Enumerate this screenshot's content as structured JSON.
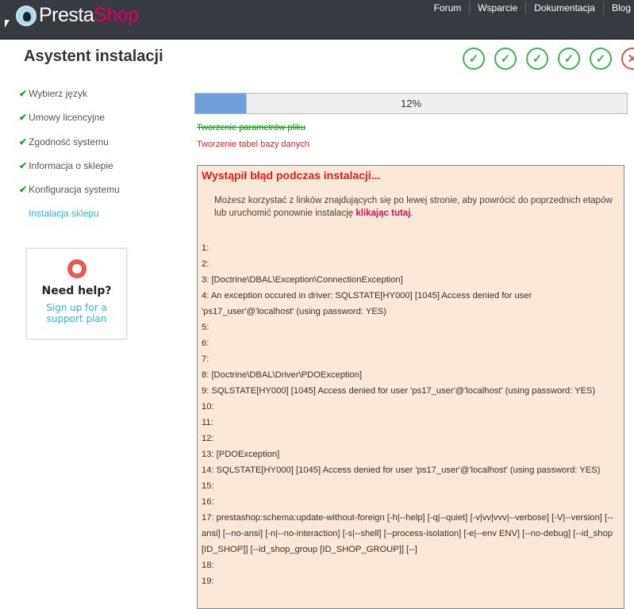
{
  "header": {
    "brand_a": "Presta",
    "brand_b": "Shop",
    "nav": [
      "Forum",
      "Wsparcie",
      "Dokumentacja",
      "Blog"
    ]
  },
  "title": "Asystent instalacji",
  "steps": [
    {
      "status": "done",
      "icon": "check-icon",
      "glyph": "✓"
    },
    {
      "status": "done",
      "icon": "check-icon",
      "glyph": "✓"
    },
    {
      "status": "done",
      "icon": "check-icon",
      "glyph": "✓"
    },
    {
      "status": "done",
      "icon": "check-icon",
      "glyph": "✓"
    },
    {
      "status": "done",
      "icon": "check-icon",
      "glyph": "✓"
    },
    {
      "status": "error",
      "icon": "cross-icon",
      "glyph": "✕"
    }
  ],
  "sidebar": {
    "items": [
      "Wybierz język",
      "Umowy licencyjne",
      "Zgodność systemu",
      "Informacja o sklepie",
      "Konfiguracja systemu"
    ],
    "current": "Instalacja sklepu",
    "check": "✔"
  },
  "help": {
    "title": "Need help?",
    "link": "Sign up for a support plan"
  },
  "progress": {
    "percent": 12,
    "label": "12%"
  },
  "tasks": {
    "done": "Tworzenie parametrów pliku",
    "failed": "Tworzenie tabel bazy danych"
  },
  "error": {
    "title": "Wystąpił błąd podczas instalacji...",
    "msg_before": "Możesz korzystać z linków znajdujących się po lewej stronie, aby powrócić do poprzednich etapów lub uruchomić ponownie instalację ",
    "msg_link": "klikając tutaj",
    "msg_after": ".",
    "lines": [
      "1:",
      "2:",
      "3: [Doctrine\\DBAL\\Exception\\ConnectionException]",
      "4: An exception occured in driver: SQLSTATE[HY000] [1045] Access denied for user 'ps17_user'@'localhost' (using password: YES)",
      "5:",
      "6:",
      "7:",
      "8: [Doctrine\\DBAL\\Driver\\PDOException]",
      "9: SQLSTATE[HY000] [1045] Access denied for user 'ps17_user'@'localhost' (using password: YES)",
      "10:",
      "11:",
      "12:",
      "13: [PDOException]",
      "14: SQLSTATE[HY000] [1045] Access denied for user 'ps17_user'@'localhost' (using password: YES)",
      "15:",
      "16:",
      "17: prestashop:schema:update-without-foreign [-h|--help] [-q|--quiet] [-v|vv|vvv|--verbose] [-V|--version] [--ansi] [--no-ansi] [-n|--no-interaction] [-s|--shell] [--process-isolation] [-e|--env ENV] [--no-debug] [--id_shop [ID_SHOP]] [--id_shop_group [ID_SHOP_GROUP]] [--]",
      "18:",
      "19:"
    ]
  },
  "colors": {
    "header": "#363a41",
    "accent": "#25b9d7",
    "brand": "#df0067",
    "success": "#3fb34f",
    "error": "#e21e1e"
  }
}
